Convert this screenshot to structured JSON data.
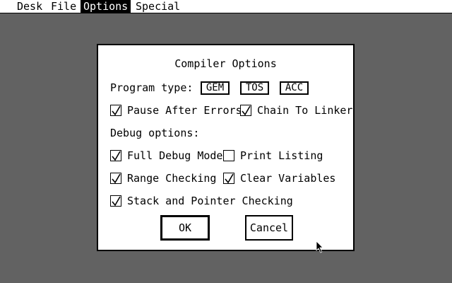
{
  "menubar": {
    "items": [
      {
        "label": "Desk",
        "active": false
      },
      {
        "label": "File",
        "active": false
      },
      {
        "label": "Options",
        "active": true
      },
      {
        "label": "Special",
        "active": false
      }
    ]
  },
  "dialog": {
    "title": "Compiler Options",
    "program_type_label": "Program type:",
    "program_types": [
      {
        "label": "GEM",
        "selected": true
      },
      {
        "label": "TOS",
        "selected": false
      },
      {
        "label": "ACC",
        "selected": false
      }
    ],
    "options": [
      {
        "label": "Pause After Errors",
        "checked": true
      },
      {
        "label": "Chain To Linker",
        "checked": true
      }
    ],
    "debug_label": "Debug options:",
    "debug_options": [
      {
        "label": "Full Debug Mode",
        "checked": true
      },
      {
        "label": "Print Listing",
        "checked": false
      },
      {
        "label": "Range Checking",
        "checked": true
      },
      {
        "label": "Clear Variables",
        "checked": true
      },
      {
        "label": "Stack and Pointer Checking",
        "checked": true
      }
    ],
    "ok_label": "OK",
    "cancel_label": "Cancel"
  },
  "icons": {
    "checkmark": "checkmark-icon",
    "cursor": "mouse-pointer-icon"
  },
  "colors": {
    "foreground": "#000000",
    "background": "#ffffff"
  }
}
